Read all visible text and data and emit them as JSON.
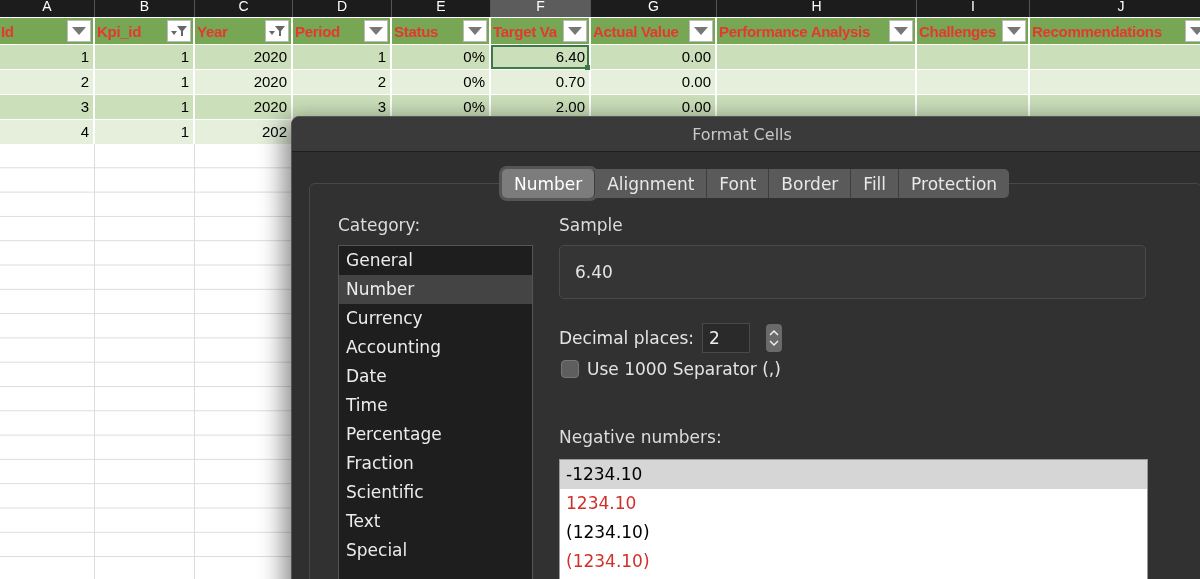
{
  "sheet": {
    "column_letters": [
      {
        "label": "A",
        "selected": false
      },
      {
        "label": "B",
        "selected": false
      },
      {
        "label": "C",
        "selected": false
      },
      {
        "label": "D",
        "selected": false
      },
      {
        "label": "E",
        "selected": false
      },
      {
        "label": "F",
        "selected": true
      },
      {
        "label": "G",
        "selected": false
      },
      {
        "label": "H",
        "selected": false
      },
      {
        "label": "I",
        "selected": false
      },
      {
        "label": "J",
        "selected": false
      }
    ],
    "header": [
      {
        "label": "Id",
        "filtered": false
      },
      {
        "label": "Kpi_id",
        "filtered": true
      },
      {
        "label": "Year",
        "filtered": true
      },
      {
        "label": "Period",
        "filtered": false
      },
      {
        "label": "Status",
        "filtered": false
      },
      {
        "label": "Target Va",
        "filtered": false
      },
      {
        "label": "Actual Value",
        "filtered": false
      },
      {
        "label": "Performance Analysis",
        "filtered": false
      },
      {
        "label": "Challenges",
        "filtered": false
      },
      {
        "label": "Recommendations",
        "filtered": false
      }
    ],
    "rows": [
      {
        "cells": [
          {
            "text": "1",
            "selected": false
          },
          {
            "text": "1",
            "selected": false
          },
          {
            "text": "2020",
            "selected": false
          },
          {
            "text": "1",
            "selected": false
          },
          {
            "text": "0%",
            "selected": false
          },
          {
            "text": "6.40",
            "selected": true
          },
          {
            "text": "0.00",
            "selected": false
          }
        ]
      },
      {
        "cells": [
          {
            "text": "2",
            "selected": false
          },
          {
            "text": "1",
            "selected": false
          },
          {
            "text": "2020",
            "selected": false
          },
          {
            "text": "2",
            "selected": false
          },
          {
            "text": "0%",
            "selected": false
          },
          {
            "text": "0.70",
            "selected": false
          },
          {
            "text": "0.00",
            "selected": false
          }
        ]
      },
      {
        "cells": [
          {
            "text": "3",
            "selected": false
          },
          {
            "text": "1",
            "selected": false
          },
          {
            "text": "2020",
            "selected": false
          },
          {
            "text": "3",
            "selected": false
          },
          {
            "text": "0%",
            "selected": false
          },
          {
            "text": "2.00",
            "selected": false
          },
          {
            "text": "0.00",
            "selected": false
          }
        ]
      },
      {
        "cells": [
          {
            "text": "4",
            "selected": false
          },
          {
            "text": "1",
            "selected": false
          },
          {
            "text": "202",
            "selected": false
          }
        ]
      }
    ]
  },
  "dialog": {
    "title": "Format Cells",
    "tabs": [
      {
        "label": "Number",
        "selected": true
      },
      {
        "label": "Alignment",
        "selected": false
      },
      {
        "label": "Font",
        "selected": false
      },
      {
        "label": "Border",
        "selected": false
      },
      {
        "label": "Fill",
        "selected": false
      },
      {
        "label": "Protection",
        "selected": false
      }
    ],
    "category": {
      "label": "Category:",
      "items": [
        {
          "label": "General",
          "selected": false
        },
        {
          "label": "Number",
          "selected": true
        },
        {
          "label": "Currency",
          "selected": false
        },
        {
          "label": "Accounting",
          "selected": false
        },
        {
          "label": "Date",
          "selected": false
        },
        {
          "label": "Time",
          "selected": false
        },
        {
          "label": "Percentage",
          "selected": false
        },
        {
          "label": "Fraction",
          "selected": false
        },
        {
          "label": "Scientific",
          "selected": false
        },
        {
          "label": "Text",
          "selected": false
        },
        {
          "label": "Special",
          "selected": false
        }
      ]
    },
    "sample": {
      "label": "Sample",
      "value": "6.40"
    },
    "decimal_places": {
      "label": "Decimal places:",
      "value": "2"
    },
    "separator": {
      "label": "Use 1000 Separator (,)",
      "checked": false
    },
    "negative_numbers": {
      "label": "Negative numbers:",
      "items": [
        {
          "label": "-1234.10",
          "color": "#000000",
          "selected": true
        },
        {
          "label": "1234.10",
          "color": "#d0302a",
          "selected": false
        },
        {
          "label": "(1234.10)",
          "color": "#000000",
          "selected": false
        },
        {
          "label": "(1234.10)",
          "color": "#d0302a",
          "selected": false
        }
      ]
    }
  }
}
